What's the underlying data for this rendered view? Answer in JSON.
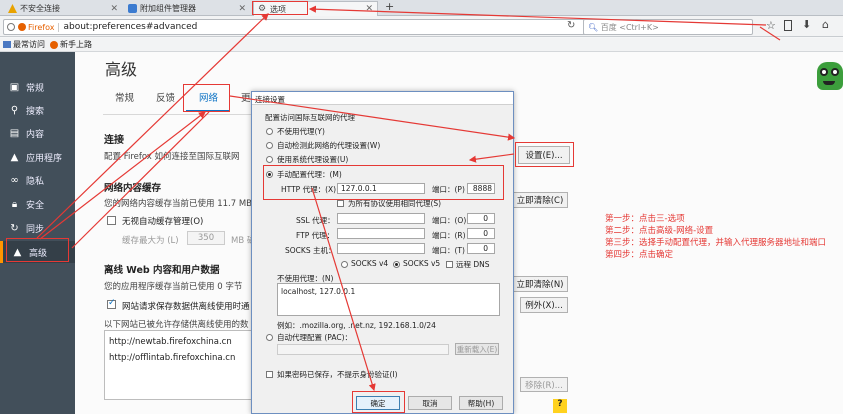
{
  "tabs": [
    {
      "label": "不安全连接"
    },
    {
      "label": "附加组件管理器"
    },
    {
      "label": "选项"
    }
  ],
  "new_tab": "+",
  "navbar": {
    "firefox_label": "Firefox",
    "url": "about:preferences#advanced",
    "search_placeholder": "百度 <Ctrl+K>"
  },
  "bookmarks": [
    {
      "label": "最常访问"
    },
    {
      "label": "新手上路"
    }
  ],
  "sidebar": {
    "items": [
      {
        "label": "常规",
        "icon": "general-icon"
      },
      {
        "label": "搜索",
        "icon": "search-icon"
      },
      {
        "label": "内容",
        "icon": "content-icon"
      },
      {
        "label": "应用程序",
        "icon": "applications-icon"
      },
      {
        "label": "隐私",
        "icon": "privacy-mask-icon"
      },
      {
        "label": "安全",
        "icon": "lock-icon"
      },
      {
        "label": "同步",
        "icon": "sync-icon"
      },
      {
        "label": "高级",
        "icon": "advanced-icon"
      }
    ]
  },
  "page": {
    "title": "高级",
    "tabs": [
      "常规",
      "反馈",
      "网络",
      "更"
    ],
    "connection_heading": "连接",
    "connection_desc": "配置 Firefox 如何连接至国际互联网",
    "settings_button": "设置(E)...",
    "cache_heading": "网络内容缓存",
    "cache_desc": "您的网络内容缓存当前已使用 11.7 MB",
    "cache_clear_button": "立即清除(C)",
    "override_cache_label": "无视自动缓存管理(O)",
    "cache_limit_label": "缓存最大为 (L)",
    "cache_limit_value": "350",
    "cache_unit": "MB 磁",
    "offline_heading": "离线 Web 内容和用户数据",
    "offline_desc": "您的应用程序缓存当前已使用 0 字节",
    "offline_clear_button": "立即清除(N)",
    "warn_label": "网站请求保存数据供离线使用时通",
    "exceptions_button": "例外(X)...",
    "allowed_sites_desc": "以下网站已被允许存储供离线使用的数",
    "sites": [
      "http://newtab.firefoxchina.cn",
      "http://offlintab.firefoxchina.cn"
    ],
    "remove_button": "移除(R)...",
    "help_icon_label": "?"
  },
  "dialog": {
    "title": "连接设置",
    "section_label": "配置访问国际互联网的代理",
    "options": [
      "不使用代理(Y)",
      "自动检测此网络的代理设置(W)",
      "使用系统代理设置(U)",
      "手动配置代理：(M)"
    ],
    "http_label": "HTTP 代理：(X)",
    "http_value": "127.0.0.1",
    "port_label": "端口：(P)",
    "http_port": "8888",
    "all_protocols_label": "为所有协议使用相同代理(S)",
    "ssl_label": "SSL 代理：",
    "ssl_port_label": "端口：(O)",
    "ftp_label": "FTP 代理：",
    "ftp_port_label": "端口：(R)",
    "socks_label": "SOCKS 主机：",
    "socks_port_label": "端口：(T)",
    "zero": "0",
    "socks4": "SOCKS v4",
    "socks5": "SOCKS v5",
    "remote_dns": "远程 DNS",
    "no_proxy_label": "不使用代理：(N)",
    "no_proxy_value": "localhost, 127.0.0.1",
    "example": "例如：.mozilla.org, .net.nz, 192.168.1.0/24",
    "auto_config_label": "自动代理配置 (PAC)：",
    "reload_button": "重新载入(E)",
    "no_auth_label": "如果密码已保存，不提示身份验证(I)",
    "ok_button": "确定",
    "cancel_button": "取消",
    "help_button": "帮助(H)"
  },
  "notes": [
    "第一步：点击三-选项",
    "第二步：点击高级-网络-设置",
    "第三步：选择手动配置代理，并输入代理服务器地址和端口",
    "第四步：点击确定"
  ],
  "colors": {
    "annotation_red": "#e53935",
    "sidebar_bg": "#424f5a",
    "accent": "#ff9500"
  }
}
